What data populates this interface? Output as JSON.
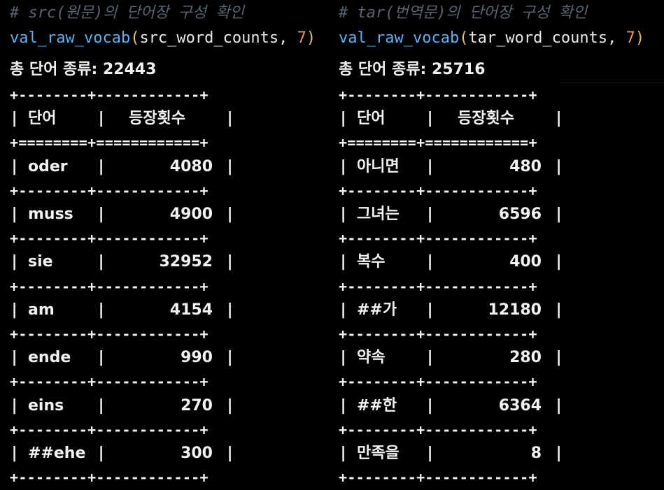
{
  "left": {
    "comment": "# src(원문)의 단어장 구성 확인",
    "code": {
      "fn": "val_raw_vocab",
      "open": "(",
      "arg": "src_word_counts, ",
      "num": "7",
      "close": ")"
    },
    "total": "총 단어 종류: 22443",
    "table": {
      "border": "+--------+------------+",
      "header_border": "+========+============+",
      "header": {
        "word": "단어",
        "count": "등장횟수"
      },
      "rows": [
        {
          "word": "oder",
          "count": "4080"
        },
        {
          "word": "muss",
          "count": "4900"
        },
        {
          "word": "sie",
          "count": "32952"
        },
        {
          "word": "am",
          "count": "4154"
        },
        {
          "word": "ende",
          "count": "990"
        },
        {
          "word": "eins",
          "count": "270"
        },
        {
          "word": "##ehe",
          "count": "300"
        }
      ]
    }
  },
  "right": {
    "comment": "# tar(번역문)의 단어장 구성 확인",
    "code": {
      "fn": "val_raw_vocab",
      "open": "(",
      "arg": "tar_word_counts, ",
      "num": "7",
      "close": ")"
    },
    "total": "총 단어 종류: 25716",
    "table": {
      "border": "+--------+------------+",
      "header_border": "+========+============+",
      "header": {
        "word": "단어",
        "count": "등장횟수"
      },
      "rows": [
        {
          "word": "아니면",
          "count": "480"
        },
        {
          "word": "그녀는",
          "count": "6596"
        },
        {
          "word": "복수",
          "count": "400"
        },
        {
          "word": "##가",
          "count": "12180"
        },
        {
          "word": "약속",
          "count": "280"
        },
        {
          "word": "##한",
          "count": "6364"
        },
        {
          "word": "만족을",
          "count": "8"
        }
      ]
    }
  },
  "colors": {
    "background": "#000000",
    "comment": "#5c6370",
    "function": "#61afef",
    "paren": "#e5c07b",
    "number": "#e5946a",
    "text": "#f2f2f2"
  }
}
